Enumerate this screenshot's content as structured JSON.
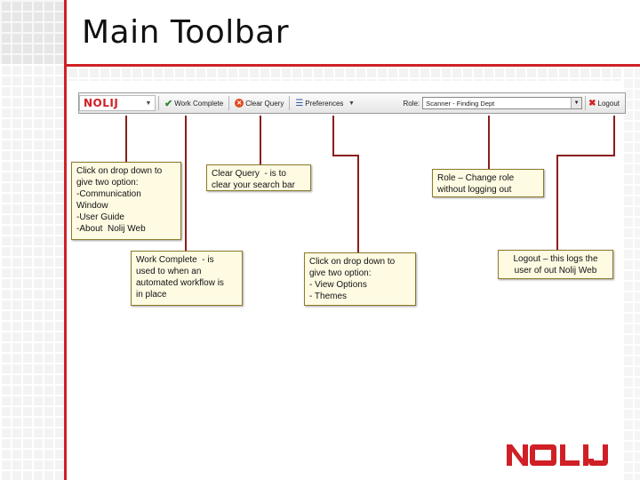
{
  "slide": {
    "title": "Main Toolbar"
  },
  "toolbar": {
    "logo_text": "NOLIJ",
    "logo_dropdown_icon": "chevron-down-icon",
    "work_complete_label": "Work Complete",
    "clear_query_label": "Clear Query",
    "preferences_label": "Preferences",
    "preferences_dropdown_icon": "chevron-down-icon",
    "role_label": "Role:",
    "role_value": "Scanner - Finding Dept",
    "logout_label": "Logout",
    "icons": {
      "work_complete": "check-icon",
      "clear_query": "clear-icon",
      "preferences": "preferences-icon",
      "logout": "logout-x-icon"
    }
  },
  "callouts": {
    "logo_menu": {
      "lines": [
        "Click on drop down to",
        "give two option:",
        "-Communication",
        "Window",
        "-User Guide",
        "-About  Nolij Web"
      ]
    },
    "clear_query": {
      "lines": [
        "Clear Query  - is to",
        "clear your search bar"
      ]
    },
    "role": {
      "lines": [
        "Role – Change role",
        "without logging out"
      ]
    },
    "work_complete": {
      "lines": [
        "Work Complete  - is",
        "used to when an",
        "automated workflow is",
        "in place"
      ]
    },
    "preferences": {
      "lines": [
        "Click on drop down to",
        "give two option:",
        "- View Options",
        "- Themes"
      ]
    },
    "logout": {
      "lines": [
        "Logout – this logs the",
        "user of out Nolij Web"
      ]
    }
  },
  "branding": {
    "footer_logo_text": "NOLIJ",
    "accent_color": "#d01f26",
    "callout_bg": "#fffbe3"
  }
}
